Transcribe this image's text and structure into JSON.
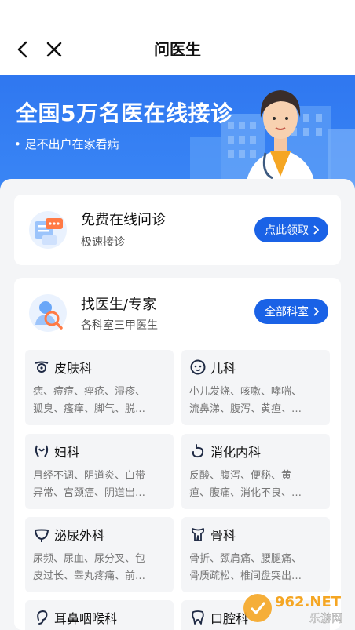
{
  "header": {
    "title": "问医生",
    "back_icon": "chevron-left-icon",
    "close_icon": "close-icon"
  },
  "banner": {
    "headline": "全国5万名医在线接诊",
    "subline": "• 足不出户在家看病"
  },
  "free_consult": {
    "title": "免费在线问诊",
    "desc": "极速接诊",
    "button_label": "点此领取"
  },
  "find_doctor": {
    "title": "找医生/专家",
    "desc": "各科室三甲医生",
    "button_label": "全部科室"
  },
  "departments": [
    {
      "name": "皮肤科",
      "line1": "痣、痘痘、痤疮、湿疹、",
      "line2": "狐臭、瘙痒、脚气、脱…",
      "icon": "skin-icon"
    },
    {
      "name": "儿科",
      "line1": "小儿发烧、咳嗽、哮喘、",
      "line2": "流鼻涕、腹泻、黄疸、…",
      "icon": "child-face-icon"
    },
    {
      "name": "妇科",
      "line1": "月经不调、阴道炎、白带",
      "line2": "异常、宫颈癌、阴道出…",
      "icon": "gynecology-icon"
    },
    {
      "name": "消化内科",
      "line1": "反酸、腹泻、便秘、黄",
      "line2": "疸、腹痛、消化不良、…",
      "icon": "stomach-icon"
    },
    {
      "name": "泌尿外科",
      "line1": "尿频、尿血、尿分叉、包",
      "line2": "皮过长、睾丸疼痛、前…",
      "icon": "bladder-icon"
    },
    {
      "name": "骨科",
      "line1": "骨折、颈肩痛、腰腿痛、",
      "line2": "骨质疏松、椎间盘突出…",
      "icon": "bone-icon"
    },
    {
      "name": "耳鼻咽喉科",
      "line1": "",
      "line2": "",
      "icon": "ear-icon"
    },
    {
      "name": "口腔科",
      "line1": "",
      "line2": "",
      "icon": "tooth-icon"
    }
  ],
  "watermark": {
    "top": "962.NET",
    "bottom": "乐游网"
  },
  "colors": {
    "primary_blue": "#1a62e6",
    "banner_blue": "#2f77f0",
    "card_bg": "#ffffff",
    "page_bg": "#f4f5f7"
  }
}
